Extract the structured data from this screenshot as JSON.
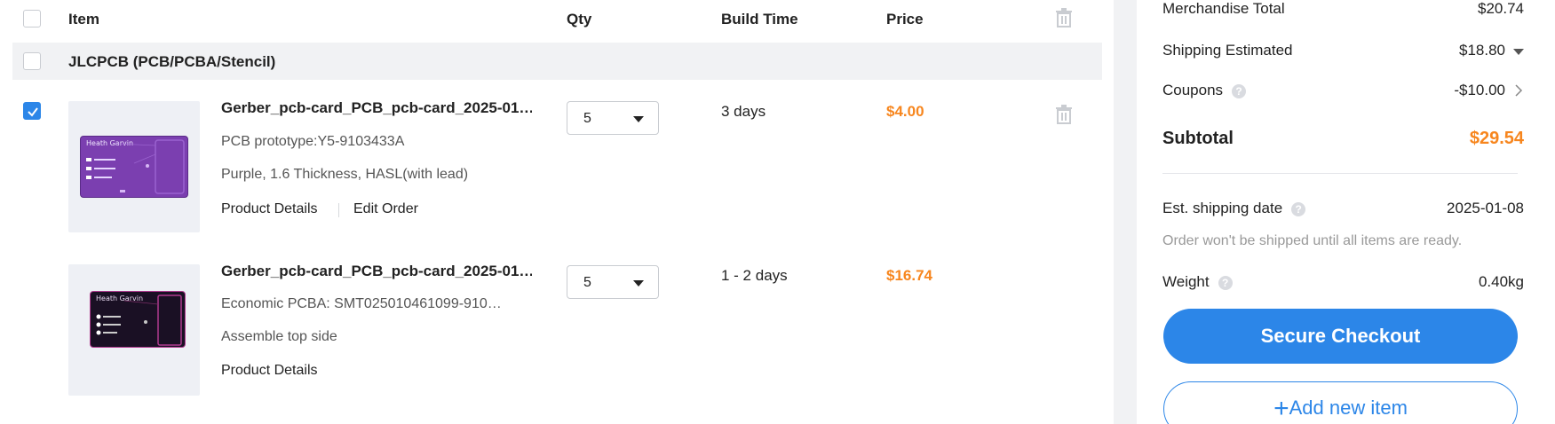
{
  "table": {
    "headers": {
      "item": "Item",
      "qty": "Qty",
      "build_time": "Build Time",
      "price": "Price"
    },
    "group": {
      "title": "JLCPCB (PCB/PCBA/Stencil)"
    },
    "items": [
      {
        "title": "Gerber_pcb-card_PCB_pcb-card_2025-01…",
        "line1": "PCB prototype:Y5-9103433A",
        "line2": "Purple, 1.6 Thickness, HASL(with lead)",
        "links": [
          "Product Details",
          "Edit Order"
        ],
        "qty": "5",
        "build_time": "3 days",
        "price": "$4.00",
        "checked": true,
        "thumb_name": "Heath Garvin"
      },
      {
        "title": "Gerber_pcb-card_PCB_pcb-card_2025-01…",
        "line1": "Economic PCBA: SMT025010461099-910…",
        "line2": "Assemble top side",
        "links": [
          "Product Details"
        ],
        "qty": "5",
        "build_time": "1 - 2 days",
        "price": "$16.74",
        "checked": false,
        "thumb_name": "Heath Garvin"
      }
    ]
  },
  "summary": {
    "merchandise_label": "Merchandise Total",
    "merchandise_value": "$20.74",
    "shipping_label": "Shipping Estimated",
    "shipping_value": "$18.80",
    "coupons_label": "Coupons",
    "coupons_value": "-$10.00",
    "subtotal_label": "Subtotal",
    "subtotal_value": "$29.54",
    "ship_date_label": "Est. shipping date",
    "ship_date_value": "2025-01-08",
    "ship_note": "Order won't be shipped until all items are ready.",
    "weight_label": "Weight",
    "weight_value": "0.40kg",
    "help_glyph": "?",
    "checkout_label": "Secure Checkout",
    "add_new_label": "Add new item",
    "add_new_glyph": "+"
  },
  "colors": {
    "accent": "#2c86e8",
    "price": "#f7861e",
    "purple_board": "#7b3fb0",
    "black_board": "#1a1024"
  },
  "icons": [
    "checkbox-icon",
    "trash-icon",
    "caret-down-icon",
    "help-icon",
    "chevron-right-icon",
    "plus-icon"
  ]
}
